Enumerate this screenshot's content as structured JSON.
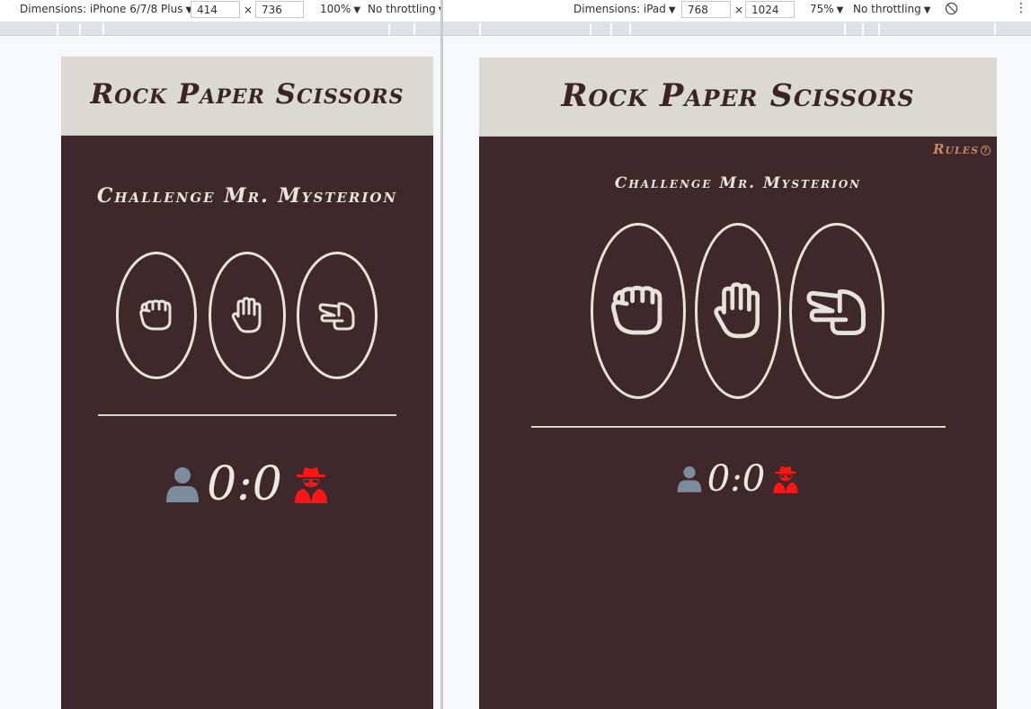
{
  "left_toolbar": {
    "dimensions_label": "Dimensions: iPhone 6/7/8 Plus",
    "width": "414",
    "height": "736",
    "times": "×",
    "zoom": "100%",
    "throttling": "No throttling"
  },
  "right_toolbar": {
    "dimensions_label": "Dimensions: iPad",
    "width": "768",
    "height": "1024",
    "times": "×",
    "zoom": "75%",
    "throttling": "No throttling"
  },
  "app": {
    "title": "Rock Paper Scissors",
    "subtitle": "Challenge Mr. Mysterion",
    "rules_label": "Rules",
    "choices": [
      {
        "icon": "hand-rock-icon"
      },
      {
        "icon": "hand-paper-icon"
      },
      {
        "icon": "hand-scissors-icon"
      }
    ],
    "score": {
      "player_icon": "user-icon",
      "player": "0",
      "separator": ":",
      "computer": "0",
      "computer_icon": "user-secret-icon"
    }
  },
  "colors": {
    "background": "#3f282c",
    "header": "#dbd9d4",
    "title": "#3c2328",
    "light": "#e6e2dc",
    "player_icon": "#7b8d9c",
    "computer_icon": "#ff1414",
    "rules": "#c58966"
  }
}
